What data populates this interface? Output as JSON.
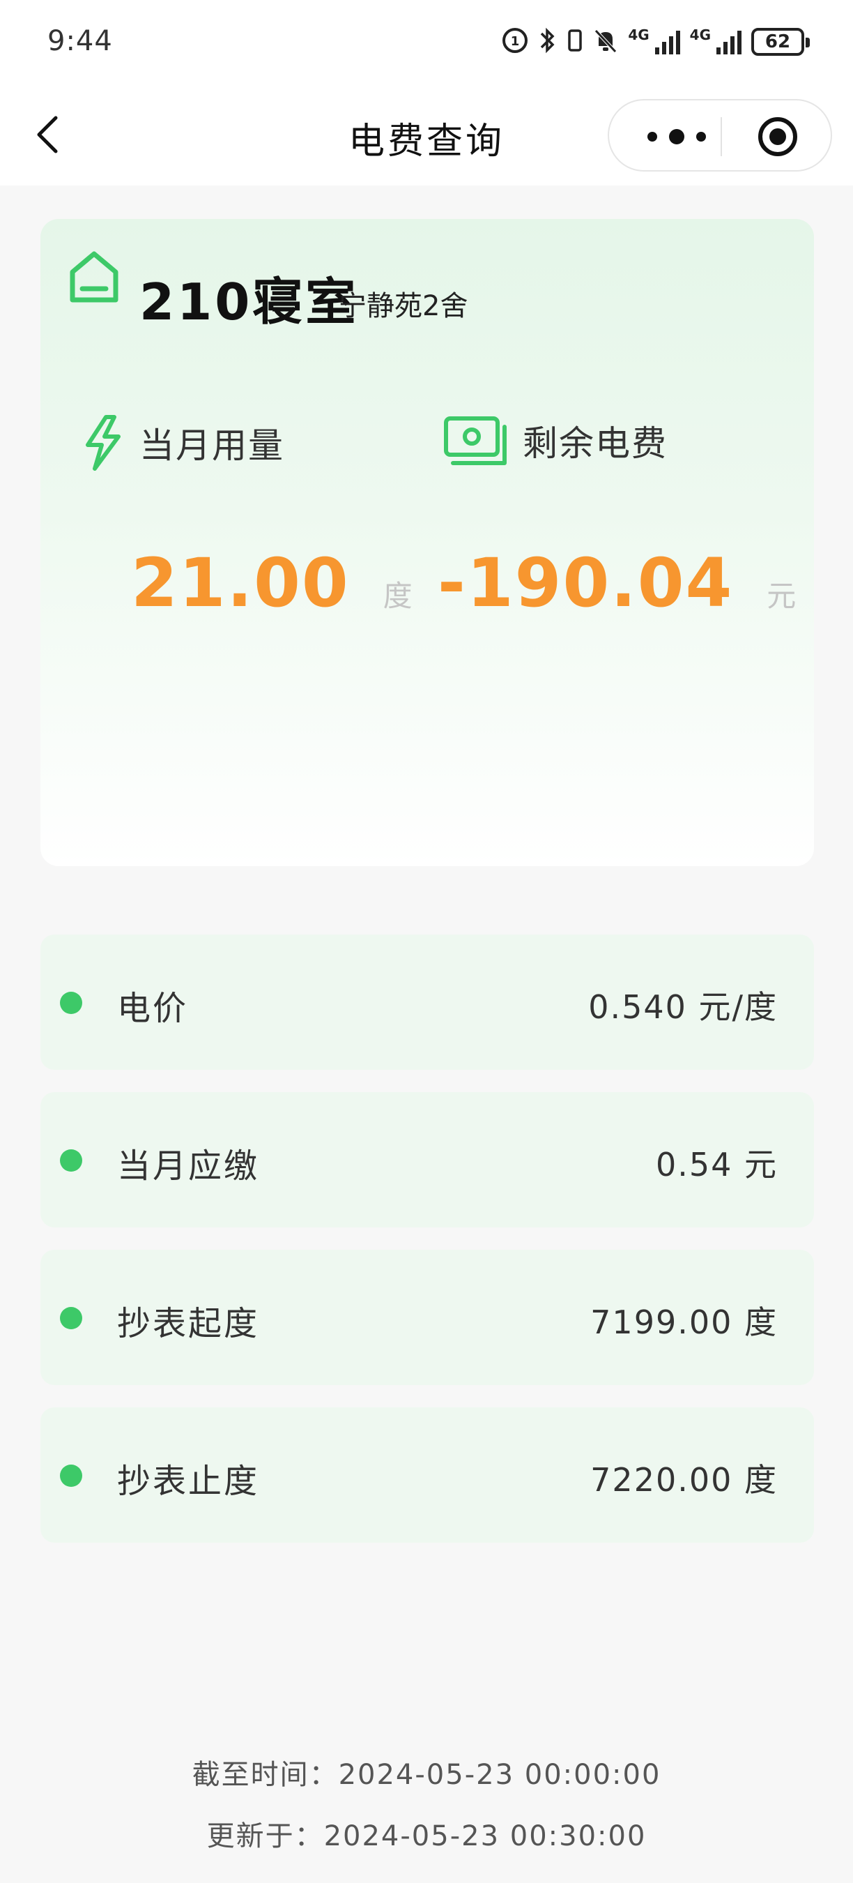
{
  "status_bar": {
    "time": "9:44",
    "network_1": "4G",
    "network_2": "4G",
    "battery": "62"
  },
  "nav": {
    "title": "电费查询"
  },
  "room": {
    "name": "210寝室",
    "building": "宁静苑2舍"
  },
  "usage": {
    "label": "当月用量",
    "value": "21.00",
    "unit": "度"
  },
  "balance": {
    "label": "剩余电费",
    "value": "-190.04",
    "unit": "元"
  },
  "details": [
    {
      "label": "电价",
      "value": "0.540 元/度"
    },
    {
      "label": "当月应缴",
      "value": "0.54 元"
    },
    {
      "label": "抄表起度",
      "value": "7199.00 度"
    },
    {
      "label": "抄表止度",
      "value": "7220.00 度"
    }
  ],
  "footer": {
    "cutoff": "截至时间：2024-05-23 00:00:00",
    "updated": "更新于：2024-05-23 00:30:00"
  },
  "colors": {
    "accent_green": "#3dc968",
    "value_orange": "#f7962f",
    "card_bg": "#e5f6e9",
    "row_bg": "#eef8f0"
  },
  "icons": [
    "back-arrow-icon",
    "more-dots-icon",
    "close-target-icon",
    "home-icon",
    "lightning-bolt-icon",
    "money-bill-icon"
  ]
}
